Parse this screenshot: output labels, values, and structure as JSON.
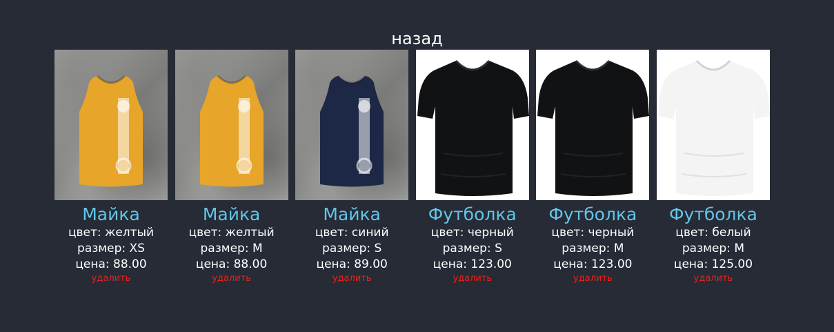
{
  "nav": {
    "back_label": "назад"
  },
  "labels": {
    "color": "цвет: ",
    "size": "размер: ",
    "price": "цена: ",
    "delete": "удалить"
  },
  "items": [
    {
      "title": "Майка",
      "color": "желтый",
      "size": "XS",
      "price": "88.00",
      "image": "tank-top-yellow",
      "bg": "concrete",
      "garment_color": "#e7a52a"
    },
    {
      "title": "Майка",
      "color": "желтый",
      "size": "M",
      "price": "88.00",
      "image": "tank-top-yellow",
      "bg": "concrete",
      "garment_color": "#e7a52a"
    },
    {
      "title": "Майка",
      "color": "синий",
      "size": "S",
      "price": "89.00",
      "image": "tank-top-navy",
      "bg": "concrete",
      "garment_color": "#1c2845"
    },
    {
      "title": "Футболка",
      "color": "черный",
      "size": "S",
      "price": "123.00",
      "image": "tshirt-black",
      "bg": "white",
      "garment_color": "#111214"
    },
    {
      "title": "Футболка",
      "color": "черный",
      "size": "M",
      "price": "123.00",
      "image": "tshirt-black",
      "bg": "white",
      "garment_color": "#111214"
    },
    {
      "title": "Футболка",
      "color": "белый",
      "size": "M",
      "price": "125.00",
      "image": "tshirt-white",
      "bg": "white",
      "garment_color": "#f4f4f4"
    }
  ],
  "colors": {
    "background": "#262b35",
    "title": "#61c5ea",
    "text": "#ffffff",
    "delete": "#e8231f"
  }
}
